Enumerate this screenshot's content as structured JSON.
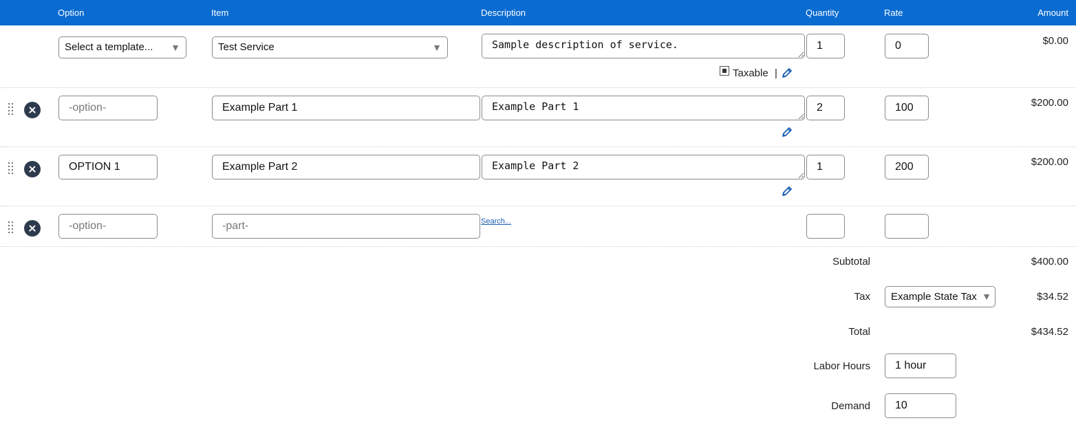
{
  "header": {
    "option": "Option",
    "item": "Item",
    "description": "Description",
    "quantity": "Quantity",
    "rate": "Rate",
    "amount": "Amount"
  },
  "template_row": {
    "template_select": "Select a template...",
    "item_select": "Test Service",
    "description": "Sample description of service.",
    "quantity": "1",
    "rate": "0",
    "amount": "$0.00",
    "taxable_label": "Taxable",
    "taxable_checked": true,
    "separator": "|"
  },
  "rows": [
    {
      "option": "",
      "option_placeholder": "-option-",
      "item": "Example Part 1",
      "description": "Example Part 1",
      "quantity": "2",
      "rate": "100",
      "amount": "$200.00"
    },
    {
      "option": "OPTION 1",
      "option_placeholder": "-option-",
      "item": "Example Part 2",
      "description": "Example Part 2",
      "quantity": "1",
      "rate": "200",
      "amount": "$200.00"
    }
  ],
  "new_row": {
    "option_placeholder": "-option-",
    "item_placeholder": "-part-",
    "search_link": "Search..."
  },
  "totals": {
    "subtotal_label": "Subtotal",
    "subtotal_value": "$400.00",
    "tax_label": "Tax",
    "tax_select": "Example State Tax",
    "tax_value": "$34.52",
    "total_label": "Total",
    "total_value": "$434.52",
    "labor_label": "Labor Hours",
    "labor_value": "1 hour",
    "demand_label": "Demand",
    "demand_value": "10"
  },
  "colors": {
    "header_bg": "#0a6bd1",
    "link": "#1a5fb4",
    "remove_button": "#2e3b4e"
  },
  "icons": [
    "drag-handle-icon",
    "remove-icon",
    "pencil-icon",
    "chevron-down-icon",
    "checkbox-icon"
  ]
}
